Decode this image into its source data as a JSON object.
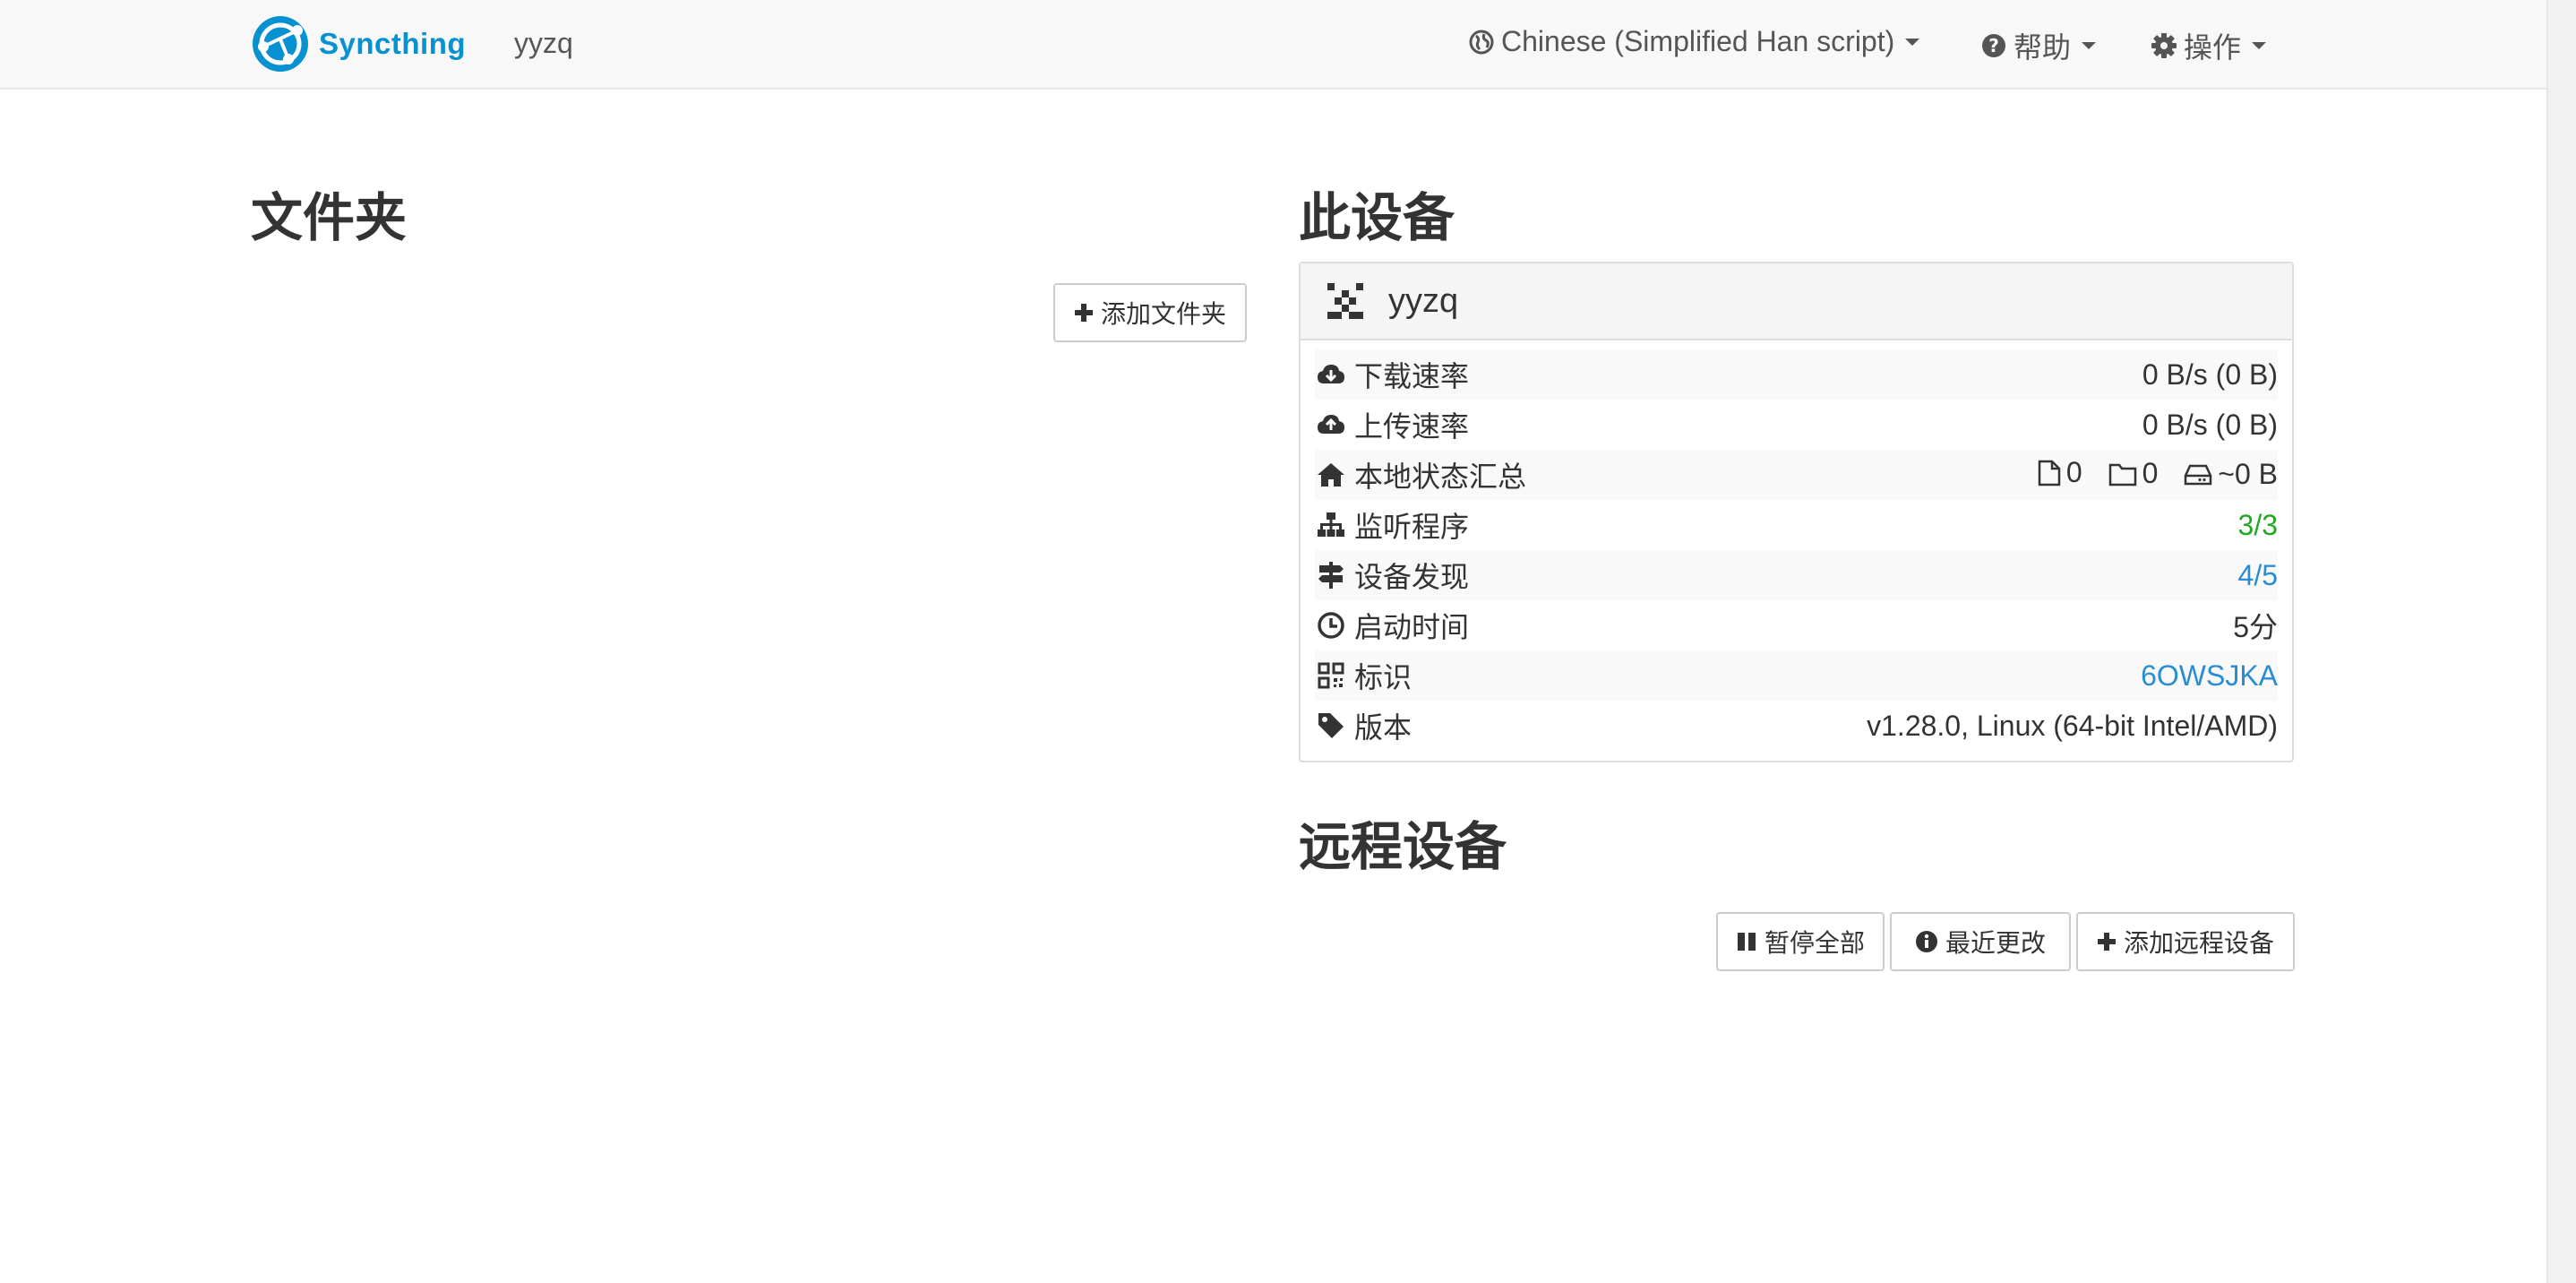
{
  "navbar": {
    "brand": "Syncthing",
    "device_name": "yyzq",
    "language": "Chinese (Simplified Han script)",
    "help": "帮助",
    "actions": "操作"
  },
  "folders": {
    "title": "文件夹",
    "add_button": "添加文件夹"
  },
  "this_device": {
    "title": "此设备",
    "name": "yyzq",
    "rows": [
      {
        "icon": "cloud-download-icon",
        "label": "下载速率",
        "value": "0 B/s (0 B)"
      },
      {
        "icon": "cloud-upload-icon",
        "label": "上传速率",
        "value": "0 B/s (0 B)"
      },
      {
        "icon": "home-icon",
        "label": "本地状态汇总",
        "files": "0",
        "dirs": "0",
        "size": "~0 B"
      },
      {
        "icon": "sitemap-icon",
        "label": "监听程序",
        "value": "3/3"
      },
      {
        "icon": "signpost-icon",
        "label": "设备发现",
        "value": "4/5"
      },
      {
        "icon": "clock-icon",
        "label": "启动时间",
        "value": "5分"
      },
      {
        "icon": "qrcode-icon",
        "label": "标识",
        "value": "6OWSJKA"
      },
      {
        "icon": "tag-icon",
        "label": "版本",
        "value": "v1.28.0, Linux (64-bit Intel/AMD)"
      }
    ]
  },
  "remote_devices": {
    "title": "远程设备",
    "pause_all": "暂停全部",
    "recent_changes": "最近更改",
    "add_remote": "添加远程设备"
  },
  "colors": {
    "brand": "#0891d1",
    "ok": "#23a823",
    "link": "#2a8dd4"
  }
}
